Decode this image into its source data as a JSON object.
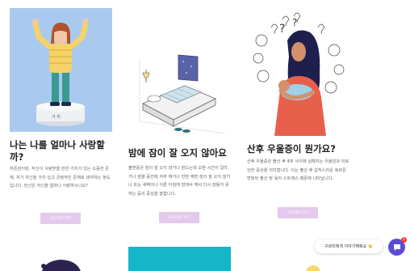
{
  "cards": [
    {
      "title": "나는 나를 얼마나 사랑할까?",
      "body": "자존감이란, 자신이 사랑받을 만한 가치가 있는 소중한 존재, 자기 자신을 가치 있고 긍정적인 존재로 생각하는 정도입니다. 당신은 자신을 얼마나 사랑하시나요?",
      "button": "검사하러 가기",
      "image_icon": "self-love-illustration-icon"
    },
    {
      "title": "밤에 잠이 잘 오지 않아요",
      "body": "불면증은 잠이 잘 오지 않거나 잠드는데 오랜 시간이 걸리거나 잠을 중간에 자주 깨거나 한번 깨면 잠이 잘 오지 않거나 또는 새벽이나 이른 아침에 잠에서 깨서 다시 잠들지 못하는 등의 증상을 말합니다.",
      "button": "검사하러 가기",
      "image_icon": "insomnia-bed-illustration-icon"
    },
    {
      "title": "산후 우울증이 뭔가요?",
      "body": "산후 우울증은 출산 후 4주 사이에 심해지는 우울감과 이로 인한 증상을 의미합니다. 이는 출산 후 갑작스러운 호르몬 변화와 출산 및 육아 스트레스 때문에 나타납니다.",
      "button": "검사하러 가기",
      "image_icon": "postpartum-mother-illustration-icon"
    }
  ],
  "chat": {
    "bubble_text": "구르미에게 이야기해줘요 👋",
    "badge_count": "1",
    "button_icon": "chat-icon"
  },
  "colors": {
    "button_bg": "#e3c9ec",
    "card1_image_bg": "#a9c9ef",
    "chat_button": "#5b4bd6",
    "badge": "#ff3b30",
    "teal_tile": "#16b6c8"
  }
}
